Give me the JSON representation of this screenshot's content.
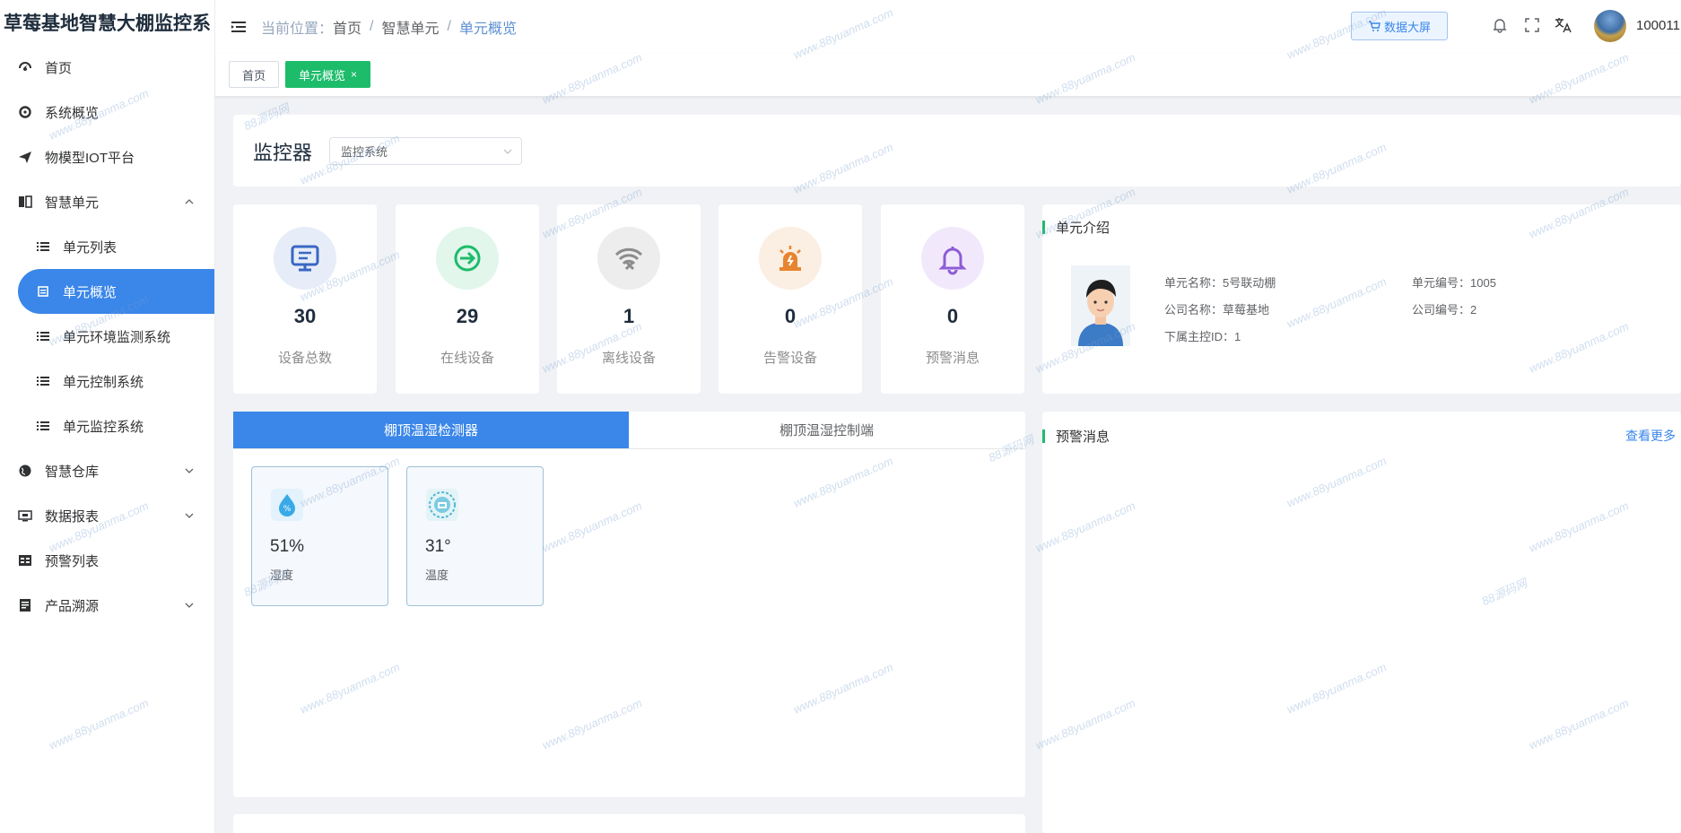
{
  "app": {
    "title": "草莓基地智慧大棚监控系"
  },
  "sidebar": {
    "items": [
      {
        "label": "首页",
        "icon": "dashboard-icon"
      },
      {
        "label": "系统概览",
        "icon": "gear-icon"
      },
      {
        "label": "物模型IOT平台",
        "icon": "send-icon"
      },
      {
        "label": "智慧单元",
        "icon": "book-icon",
        "expanded": true
      },
      {
        "label": "智慧仓库",
        "icon": "globe-icon"
      },
      {
        "label": "数据报表",
        "icon": "monitor-icon"
      },
      {
        "label": "预警列表",
        "icon": "table-icon"
      },
      {
        "label": "产品溯源",
        "icon": "archive-icon"
      }
    ],
    "subitems": [
      {
        "label": "单元列表"
      },
      {
        "label": "单元概览",
        "active": true
      },
      {
        "label": "单元环境监测系统"
      },
      {
        "label": "单元控制系统"
      },
      {
        "label": "单元监控系统"
      }
    ]
  },
  "header": {
    "breadcrumb_prefix": "当前位置：",
    "breadcrumbs": [
      "首页",
      "智慧单元",
      "单元概览"
    ],
    "separator": "/",
    "data_screen_label": "数据大屏",
    "user_id": "100011"
  },
  "tags": [
    {
      "label": "首页"
    },
    {
      "label": "单元概览",
      "close": "×",
      "active": true
    }
  ],
  "monitor": {
    "title": "监控器",
    "select_value": "监控系统"
  },
  "stats": [
    {
      "value": "30",
      "label": "设备总数",
      "color": "#3a67c4",
      "bg": "#e6edf8"
    },
    {
      "value": "29",
      "label": "在线设备",
      "color": "#1dbc6b",
      "bg": "#e2f6ec"
    },
    {
      "value": "1",
      "label": "离线设备",
      "color": "#8c8c8c",
      "bg": "#ededed"
    },
    {
      "value": "0",
      "label": "告警设备",
      "color": "#e8842f",
      "bg": "#fbeee2"
    },
    {
      "value": "0",
      "label": "预警消息",
      "color": "#8d5cd6",
      "bg": "#f1e9fb"
    }
  ],
  "unit_intro": {
    "title": "单元介绍",
    "name": "单元名称：5号联动棚",
    "number": "单元编号：1005",
    "company": "公司名称：草莓基地",
    "company_number": "公司编号：2",
    "controller": "下属主控ID：1"
  },
  "tabs": [
    "棚顶温湿检测器",
    "棚顶温湿控制端"
  ],
  "sensors": [
    {
      "value": "51%",
      "label": "湿度",
      "icon": "water-drop-icon"
    },
    {
      "value": "31°",
      "label": "温度",
      "icon": "thermometer-icon"
    }
  ],
  "warning": {
    "title": "预警消息",
    "more": "查看更多"
  },
  "watermark": "www.88yuanma.com",
  "watermark_short": "88源码网"
}
